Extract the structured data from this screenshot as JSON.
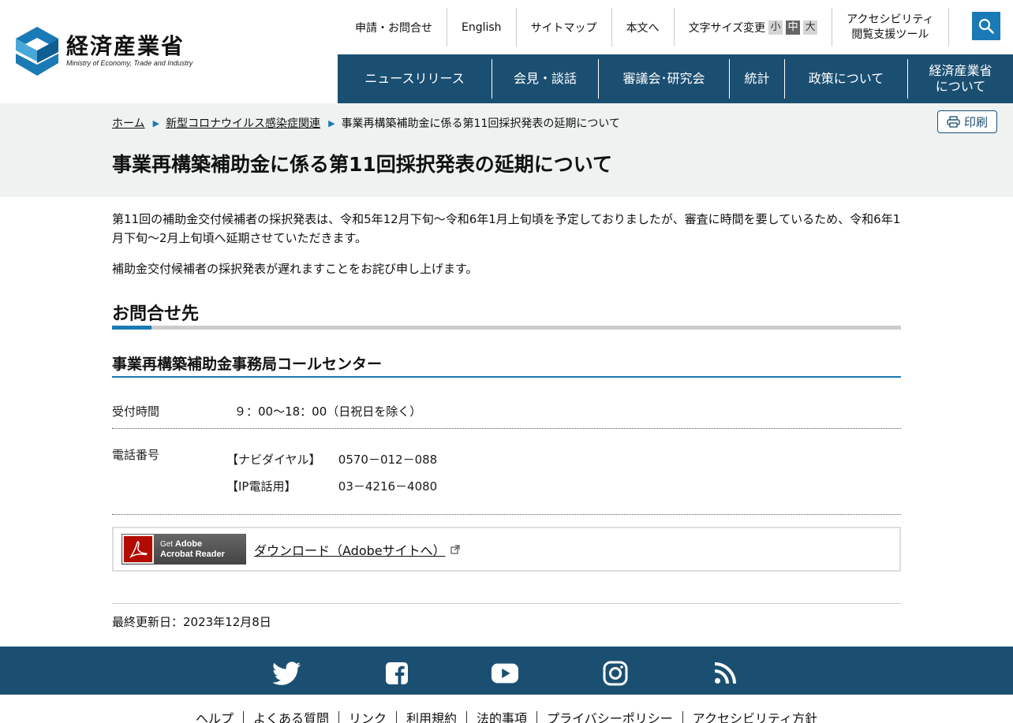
{
  "header": {
    "logo_jp": "経済産業省",
    "logo_en": "Ministry of Economy, Trade and Industry",
    "util_links": [
      "申請・お問合せ",
      "English",
      "サイトマップ",
      "本文へ"
    ],
    "font_size_label": "文字サイズ変更",
    "font_sizes": [
      "小",
      "中",
      "大"
    ],
    "font_size_selected": "中",
    "accessibility_line1": "アクセシビリティ",
    "accessibility_line2": "閲覧支援ツール",
    "search_icon": "search-icon"
  },
  "gnav": [
    {
      "label": "ニュースリリース"
    },
    {
      "label": "会見・談話"
    },
    {
      "label": "審議会･研究会"
    },
    {
      "label": "統計"
    },
    {
      "label": "政策について"
    },
    {
      "label": "経済産業省\nについて"
    }
  ],
  "breadcrumb": {
    "home": "ホーム",
    "parent": "新型コロナウイルス感染症関連",
    "current": "事業再構築補助金に係る第11回採択発表の延期について"
  },
  "print_label": "印刷",
  "page_title": "事業再構築補助金に係る第11回採択発表の延期について",
  "body": {
    "para1": "第11回の補助金交付候補者の採択発表は、令和5年12月下旬～令和6年1月上旬頃を予定しておりましたが、審査に時間を要しているため、令和6年1月下旬～2月上旬頃へ延期させていただきます。",
    "para2": "補助金交付候補者の採択発表が遅れますことをお詫び申し上げます。"
  },
  "contact": {
    "heading": "お問合せ先",
    "office": "事業再構築補助金事務局コールセンター",
    "hours_label": "受付時間",
    "hours_value": "９：00～18：00（日祝日を除く）",
    "phone_label": "電話番号",
    "phones": [
      {
        "label": "【ナビダイヤル】",
        "number": "0570－012－088"
      },
      {
        "label": "【IP電話用】",
        "number": "03－4216－4080"
      }
    ]
  },
  "adobe": {
    "badge_line1": "Get",
    "badge_brand": "Adobe",
    "badge_line2": "Acrobat Reader",
    "download_label": "ダウンロード（Adobeサイトへ）"
  },
  "last_updated": "最終更新日：2023年12月8日",
  "footer": {
    "social": [
      "twitter-icon",
      "facebook-icon",
      "youtube-icon",
      "instagram-icon",
      "rss-icon"
    ],
    "links": [
      "ヘルプ",
      "よくある質問",
      "リンク",
      "利用規約",
      "法的事項",
      "プライバシーポリシー",
      "アクセシビリティ方針"
    ]
  },
  "colors": {
    "nav_blue": "#1b4f72",
    "accent_blue": "#1a7ab5",
    "band_bg": "#eef2f1"
  }
}
